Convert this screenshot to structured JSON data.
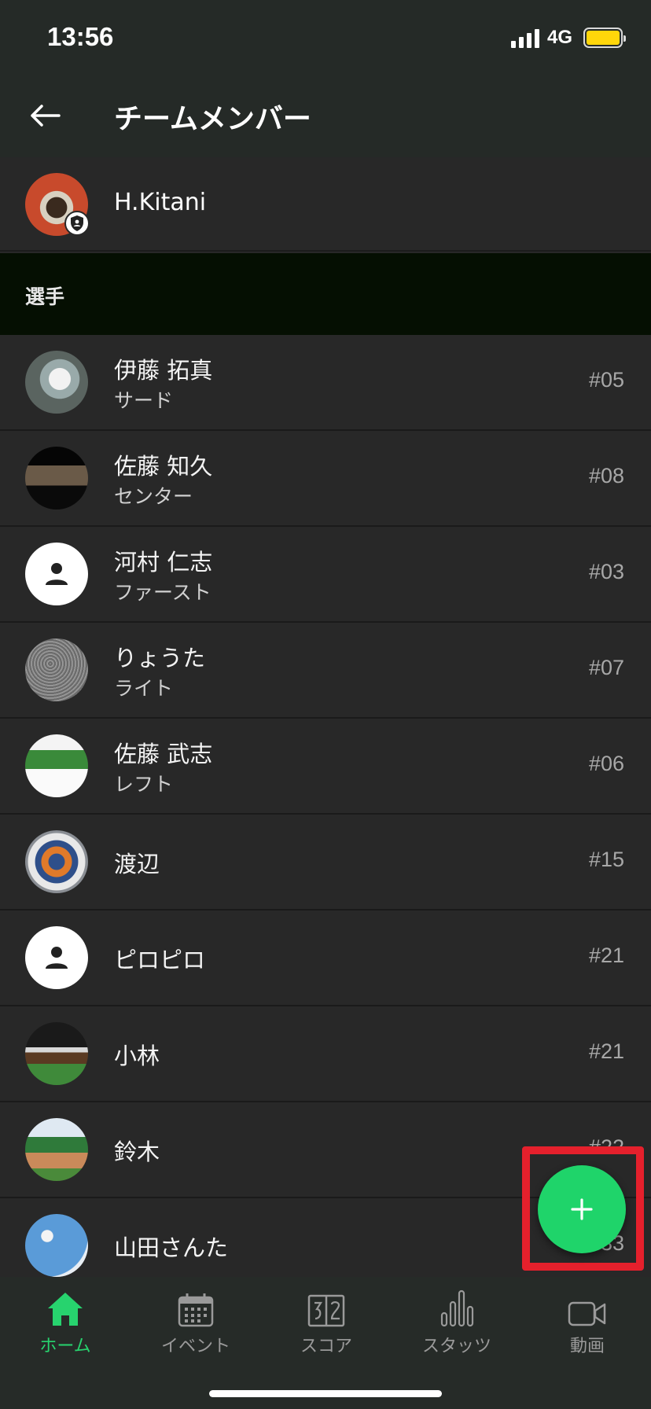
{
  "status_bar": {
    "time": "13:56",
    "network": "4G"
  },
  "header": {
    "title": "チームメンバー"
  },
  "owner": {
    "name": "H.Kitani"
  },
  "section": {
    "label": "選手"
  },
  "members": [
    {
      "name": "伊藤 拓真",
      "position": "サード",
      "number": "#05"
    },
    {
      "name": "佐藤 知久",
      "position": "センター",
      "number": "#08"
    },
    {
      "name": "河村 仁志",
      "position": "ファースト",
      "number": "#03"
    },
    {
      "name": "りょうた",
      "position": "ライト",
      "number": "#07"
    },
    {
      "name": "佐藤 武志",
      "position": "レフト",
      "number": "#06"
    },
    {
      "name": "渡辺",
      "position": "",
      "number": "#15"
    },
    {
      "name": "ピロピロ",
      "position": "",
      "number": "#21"
    },
    {
      "name": "小林",
      "position": "",
      "number": "#21"
    },
    {
      "name": "鈴木",
      "position": "",
      "number": "#22"
    },
    {
      "name": "山田さんた",
      "position": "",
      "number": "#33"
    }
  ],
  "tabs": [
    {
      "label": "ホーム",
      "icon": "home-icon",
      "active": true
    },
    {
      "label": "イベント",
      "icon": "calendar-icon",
      "active": false
    },
    {
      "label": "スコア",
      "icon": "scoreboard-icon",
      "active": false
    },
    {
      "label": "スタッツ",
      "icon": "stats-icon",
      "active": false
    },
    {
      "label": "動画",
      "icon": "video-icon",
      "active": false
    }
  ],
  "colors": {
    "accent": "#27d36e",
    "fab": "#1fd46a",
    "highlight": "#e5202c",
    "header_bg": "#252a27",
    "section_bg": "#050f02"
  }
}
